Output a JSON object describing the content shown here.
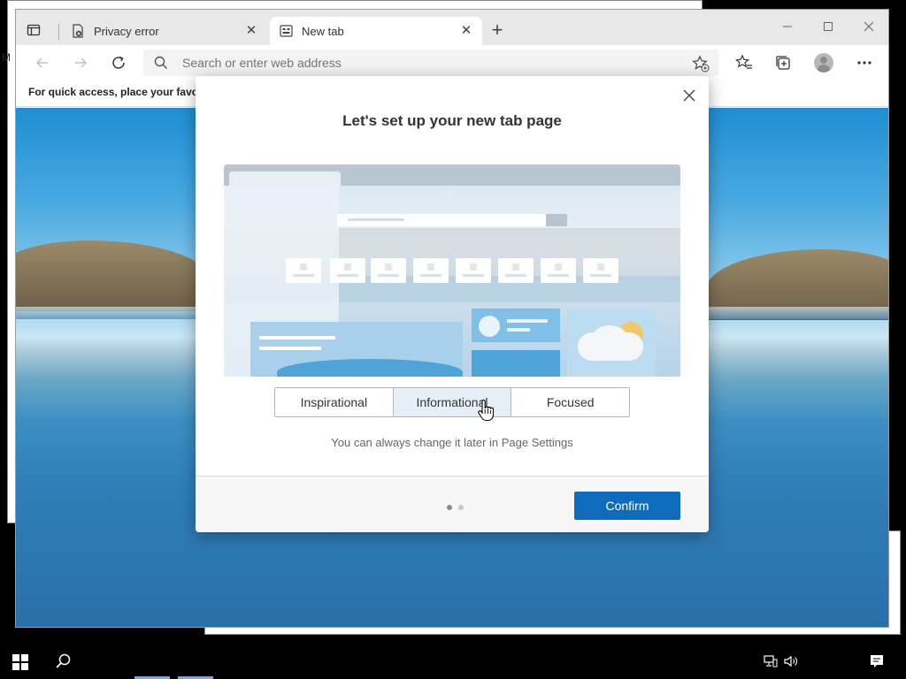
{
  "background": {
    "left_fragment_text": "M"
  },
  "browser": {
    "tabs": [
      {
        "title": "Privacy error",
        "icon": "privacy-error-icon",
        "active": false
      },
      {
        "title": "New tab",
        "icon": "new-tab-page-icon",
        "active": true
      }
    ],
    "address_bar": {
      "placeholder": "Search or enter web address"
    },
    "favorites_bar": {
      "text": "For quick access, place your favorit"
    },
    "colors": {
      "accent": "#0f6cbd",
      "tabstrip": "#e8e8e8"
    }
  },
  "dialog": {
    "title": "Let's set up your new tab page",
    "options": [
      "Inspirational",
      "Informational",
      "Focused"
    ],
    "selected_option": "Informational",
    "hint": "You can always change it later in Page Settings",
    "pagination": {
      "current": 1,
      "total": 2
    },
    "confirm_label": "Confirm"
  }
}
